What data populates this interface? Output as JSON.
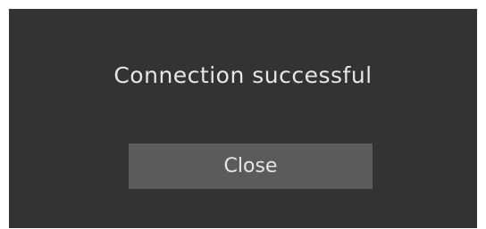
{
  "dialog": {
    "message": "Connection successful",
    "close_label": "Close"
  },
  "colors": {
    "background": "#ffffff",
    "dialog": "#333333",
    "button": "#5b5b5b",
    "text": "#e6e6e6"
  }
}
